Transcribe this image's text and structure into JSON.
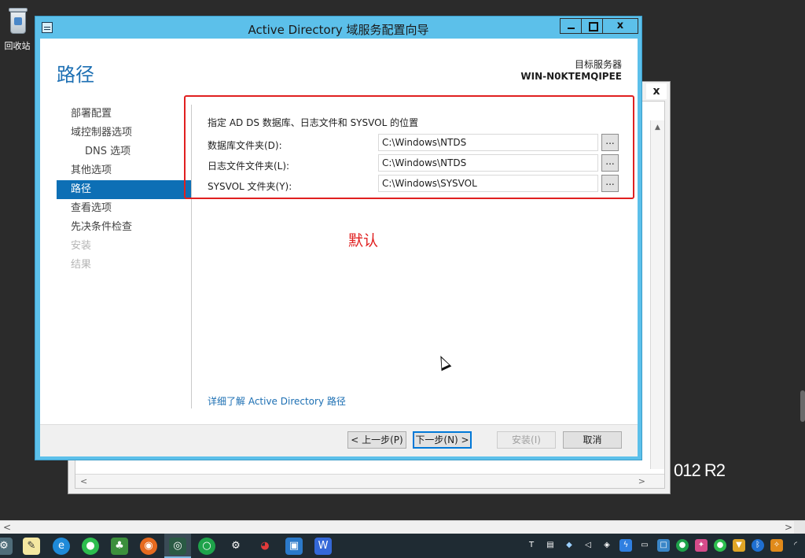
{
  "desktop": {
    "recycle_bin_label": "回收站",
    "bg_window_text": "012 R2",
    "bg_window_close": "x"
  },
  "window": {
    "title": "Active Directory 域服务配置向导",
    "minimize": "",
    "maximize": "",
    "close": "x"
  },
  "header": {
    "page_title": "路径",
    "target_label": "目标服务器",
    "target_name": "WIN-N0KTEMQIPEE"
  },
  "nav": {
    "items": [
      {
        "label": "部署配置",
        "state": "normal"
      },
      {
        "label": "域控制器选项",
        "state": "normal"
      },
      {
        "label": "DNS 选项",
        "state": "sub"
      },
      {
        "label": "其他选项",
        "state": "normal"
      },
      {
        "label": "路径",
        "state": "active"
      },
      {
        "label": "查看选项",
        "state": "normal"
      },
      {
        "label": "先决条件检查",
        "state": "normal"
      },
      {
        "label": "安装",
        "state": "disabled"
      },
      {
        "label": "结果",
        "state": "disabled"
      }
    ]
  },
  "content": {
    "section_label": "指定 AD DS 数据库、日志文件和 SYSVOL 的位置",
    "rows": [
      {
        "label": "数据库文件夹(D):",
        "value": "C:\\Windows\\NTDS",
        "browse": "..."
      },
      {
        "label": "日志文件文件夹(L):",
        "value": "C:\\Windows\\NTDS",
        "browse": "..."
      },
      {
        "label": "SYSVOL 文件夹(Y):",
        "value": "C:\\Windows\\SYSVOL",
        "browse": "..."
      }
    ],
    "annotation": "默认",
    "learn_more": "详细了解 Active Directory 路径"
  },
  "footer": {
    "prev": "< 上一步(P)",
    "next": "下一步(N) >",
    "install": "安装(I)",
    "cancel": "取消"
  },
  "colors": {
    "titlebar": "#5cc0ea",
    "accent": "#1c6fb3",
    "nav_active": "#0d6fb5",
    "annotation": "#e02020"
  },
  "taskbar": {
    "apps": [
      "settings-app-icon",
      "notepad-icon",
      "edge-icon",
      "wechat-icon",
      "clover-icon",
      "firefox-icon",
      "terminal-eye-icon",
      "green-circle-icon",
      "gear-icon",
      "weibo-icon",
      "photos-icon",
      "wps-icon"
    ],
    "tray": [
      "tb-icon",
      "printer-icon",
      "package-icon",
      "mute-icon",
      "shield-icon",
      "lightning-icon",
      "battery-icon",
      "window-icon",
      "green-app-icon",
      "color-app-icon",
      "wechat-tray-icon",
      "security-icon",
      "bluetooth-icon",
      "tool-icon",
      "wifi-icon"
    ]
  }
}
